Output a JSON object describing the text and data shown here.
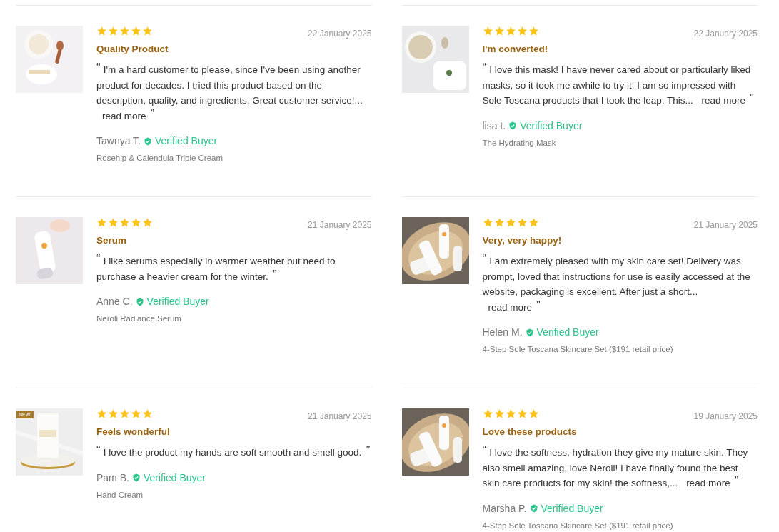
{
  "reviews": [
    {
      "stars": 5,
      "date": "22 January 2025",
      "title": "Quality Product",
      "open_quote": "“",
      "body": "I'm a hard customer to please, since I've been using another product for decades. I tried this product based on the description, quality, and ingredients. Great customer service!...",
      "read_more": "read more",
      "close_quote": "”",
      "author": "Tawnya T.",
      "verified": "Verified Buyer",
      "product": "Rosehip & Calendula Triple Cream"
    },
    {
      "stars": 5,
      "date": "22 January 2025",
      "title": "I'm converted!",
      "open_quote": "“",
      "body": "I love this mask! I have never cared about or particularly liked masks, so it took me awhile to try it. I am so impressed with Sole Toscana products that I took the leap. This...",
      "read_more": "read more",
      "close_quote": "”",
      "author": "lisa t.",
      "verified": "Verified Buyer",
      "product": "The Hydrating Mask"
    },
    {
      "stars": 5,
      "date": "21 January 2025",
      "title": "Serum",
      "open_quote": "“",
      "body": "I like serums especially in warmer weather but need to purchase a heavier cream for the winter.",
      "close_quote": "”",
      "author": "Anne C.",
      "verified": "Verified Buyer",
      "product": "Neroli Radiance Serum"
    },
    {
      "stars": 5,
      "date": "21 January 2025",
      "title": "Very, very happy!",
      "open_quote": "“",
      "body": "I am extremely pleased with my skin care set! Delivery was prompt, loved that instructions for use is easily accessed at the website, packaging is excellent. After just a short...",
      "read_more": "read more",
      "close_quote": "”",
      "author": "Helen M.",
      "verified": "Verified Buyer",
      "product": "4-Step Sole Toscana Skincare Set ($191 retail price)"
    },
    {
      "stars": 5,
      "date": "21 January 2025",
      "title": "Feels wonderful",
      "badge": "NEW!",
      "open_quote": "“",
      "body": "I love the product my hands are soft smooth and smell good.",
      "close_quote": "”",
      "author": "Pam B.",
      "verified": "Verified Buyer",
      "product": "Hand Cream"
    },
    {
      "stars": 5,
      "date": "19 January 2025",
      "title": "Love these products",
      "open_quote": "“",
      "body": "I love the softness, hydration they give my mature skin. They also smell amazing, love Neroli! I have finally found the best skin care products for my skin! the softness,...",
      "read_more": "read more",
      "close_quote": "”",
      "author": "Marsha P.",
      "verified": "Verified Buyer",
      "product": "4-Step Sole Toscana Skincare Set ($191 retail price)"
    }
  ]
}
